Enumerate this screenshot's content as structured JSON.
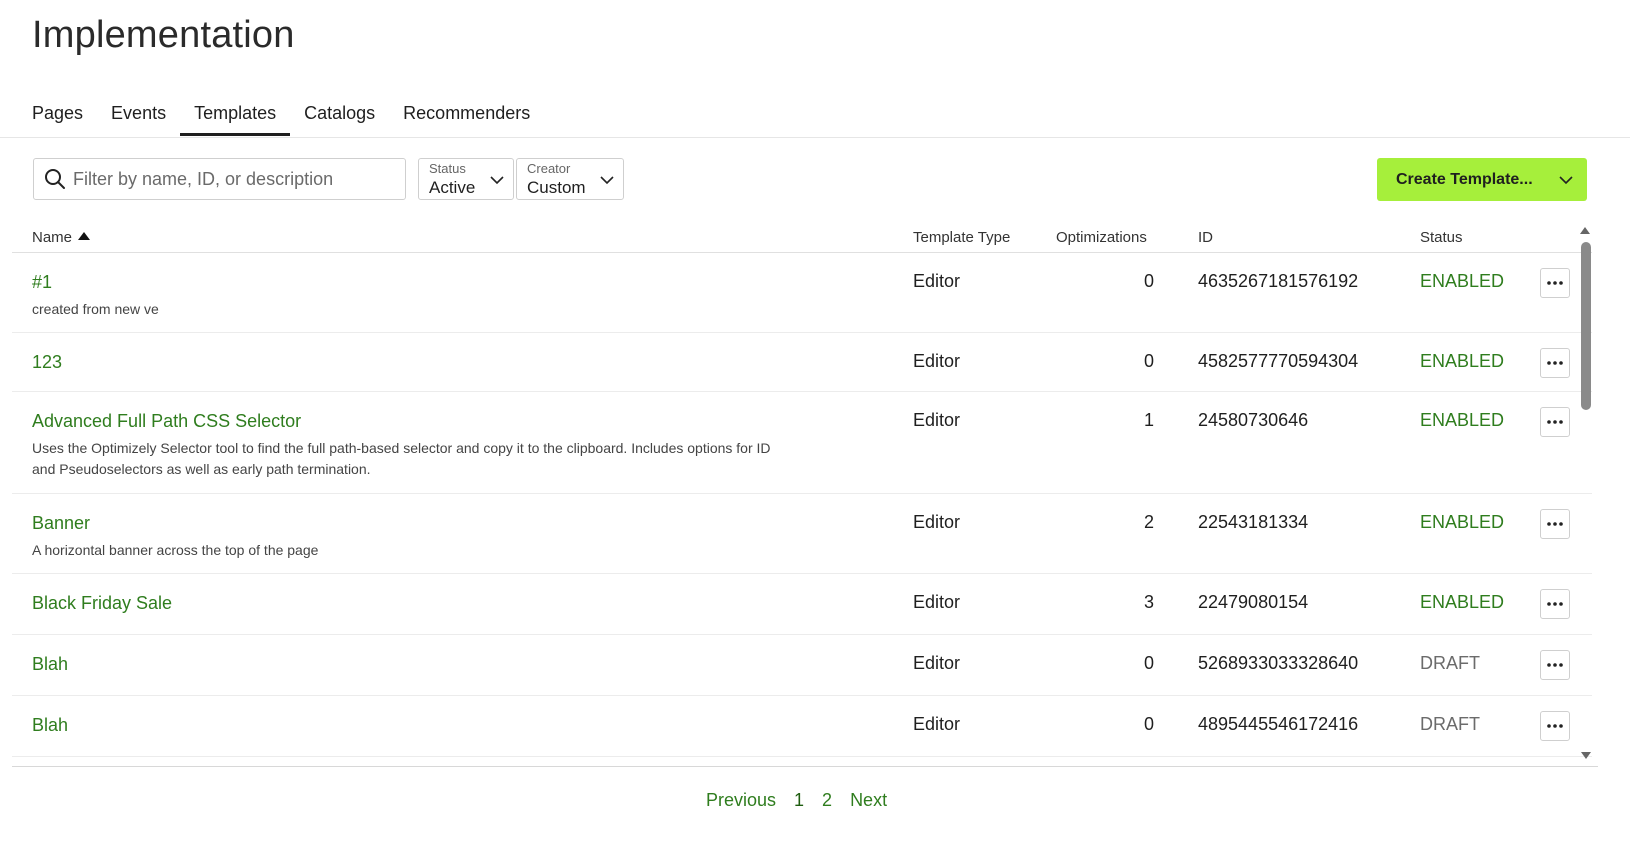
{
  "page": {
    "title": "Implementation"
  },
  "tabs": [
    {
      "label": "Pages"
    },
    {
      "label": "Events"
    },
    {
      "label": "Templates",
      "active": true
    },
    {
      "label": "Catalogs"
    },
    {
      "label": "Recommenders"
    }
  ],
  "filters": {
    "search_placeholder": "Filter by name, ID, or description",
    "status": {
      "label": "Status",
      "value": "Active"
    },
    "creator": {
      "label": "Creator",
      "value": "Custom"
    }
  },
  "actions": {
    "create_label": "Create Template..."
  },
  "table": {
    "columns": {
      "name": "Name",
      "type": "Template Type",
      "optimizations": "Optimizations",
      "id": "ID",
      "status": "Status"
    },
    "sort": {
      "column": "Name",
      "direction": "ascending"
    },
    "rows": [
      {
        "name": "#1",
        "description": "created from new ve",
        "type": "Editor",
        "optimizations": "0",
        "id": "4635267181576192",
        "status": "ENABLED"
      },
      {
        "name": "123",
        "description": "",
        "type": "Editor",
        "optimizations": "0",
        "id": "4582577770594304",
        "status": "ENABLED"
      },
      {
        "name": "Advanced Full Path CSS Selector",
        "description": "Uses the Optimizely Selector tool to find the full path-based selector and copy it to the clipboard. Includes options for ID and Pseudoselectors as well as early path termination.",
        "type": "Editor",
        "optimizations": "1",
        "id": "24580730646",
        "status": "ENABLED"
      },
      {
        "name": "Banner",
        "description": "A horizontal banner across the top of the page",
        "type": "Editor",
        "optimizations": "2",
        "id": "22543181334",
        "status": "ENABLED"
      },
      {
        "name": "Black Friday Sale",
        "description": "",
        "type": "Editor",
        "optimizations": "3",
        "id": "22479080154",
        "status": "ENABLED"
      },
      {
        "name": "Blah",
        "description": "",
        "type": "Editor",
        "optimizations": "0",
        "id": "5268933033328640",
        "status": "DRAFT"
      },
      {
        "name": "Blah",
        "description": "",
        "type": "Editor",
        "optimizations": "0",
        "id": "4895445546172416",
        "status": "DRAFT"
      }
    ]
  },
  "pagination": {
    "previous": "Previous",
    "pages": [
      "1",
      "2"
    ],
    "current": "1",
    "next": "Next"
  },
  "colors": {
    "accent": "#a6ef3b",
    "link": "#2f7d1e",
    "enabled": "#2f7d1e",
    "draft": "#6b6b6b"
  }
}
